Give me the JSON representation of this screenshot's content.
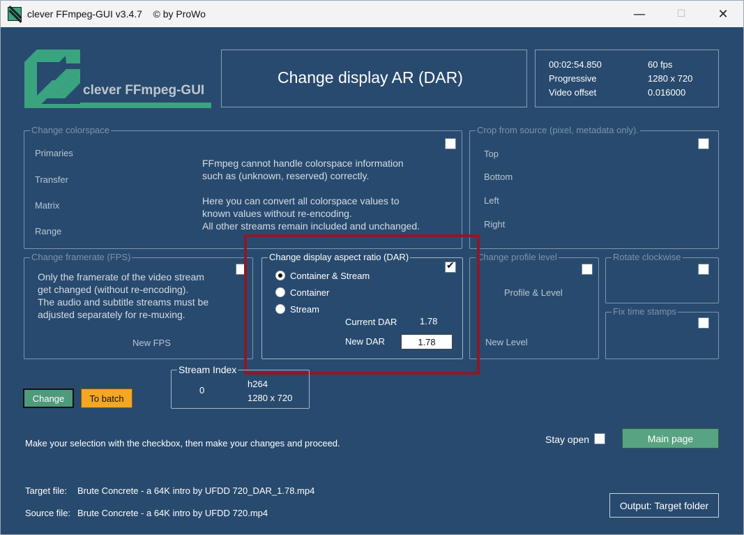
{
  "window": {
    "title": "clever FFmpeg-GUI v3.4.7    © by ProWo",
    "minimize_icon": "minimize-icon",
    "maximize_icon": "maximize-icon",
    "close_icon": "close-icon"
  },
  "logo": {
    "text": "clever FFmpeg-GUI"
  },
  "header": {
    "title": "Change display AR (DAR)"
  },
  "info": {
    "duration": "00:02:54.850",
    "fps": "60 fps",
    "scan": "Progressive",
    "resolution": "1280 x 720",
    "video_offset_label": "Video offset",
    "video_offset_value": "0.016000"
  },
  "colorspace": {
    "legend": "Change colorspace",
    "primaries": "Primaries",
    "transfer": "Transfer",
    "matrix": "Matrix",
    "range": "Range",
    "note1": "FFmpeg cannot handle colorspace information",
    "note2": "such as (unknown, reserved) correctly.",
    "note3": "Here you can convert all colorspace values to",
    "note4": "known values without re-encoding.",
    "note5": "All other streams remain included and unchanged."
  },
  "crop": {
    "legend": "Crop from source (pixel, metadata only).",
    "top": "Top",
    "bottom": "Bottom",
    "left": "Left",
    "right": "Right"
  },
  "framerate": {
    "legend": "Change framerate (FPS)",
    "line1": "Only the framerate of the video stream",
    "line2": "get changed (without re-encoding).",
    "line3": "The audio and subtitle streams must be",
    "line4": "adjusted separately for re-muxing.",
    "new_fps": "New FPS"
  },
  "dar": {
    "legend": "Change display aspect ratio (DAR)",
    "options": [
      "Container & Stream",
      "Container",
      "Stream"
    ],
    "selected": "Container & Stream",
    "checked": true,
    "current_label": "Current DAR",
    "current_value": "1.78",
    "new_label": "New DAR",
    "new_value": "1.78"
  },
  "profile": {
    "legend": "Change profile level",
    "profile_level": "Profile  &  Level",
    "new_level": "New Level"
  },
  "rotate": {
    "legend": "Rotate clockwise"
  },
  "timestamps": {
    "legend": "Fix time stamps"
  },
  "stream": {
    "legend": "Stream Index",
    "index": "0",
    "codec": "h264",
    "resolution": "1280 x 720"
  },
  "actions": {
    "change": "Change",
    "to_batch": "To batch",
    "stay_open": "Stay open",
    "main_page": "Main page",
    "output": "Output: Target folder"
  },
  "instructions": "Make your selection with the checkbox, then make your changes and proceed.",
  "files": {
    "target_label": "Target file:",
    "target_value": "Brute Concrete - a 64K intro by UFDD 720_DAR_1.78.mp4",
    "source_label": "Source file:",
    "source_value": "Brute Concrete - a 64K intro by UFDD 720.mp4"
  },
  "colors": {
    "background": "#284a6e",
    "accent_green": "#58a381",
    "batch_orange": "#f5a623",
    "highlight_red": "#8b1a25"
  }
}
